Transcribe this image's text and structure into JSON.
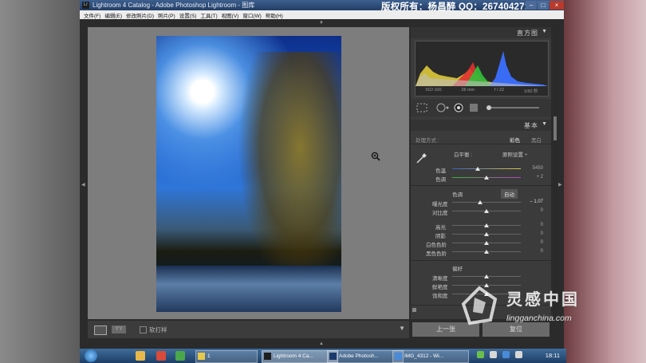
{
  "window": {
    "app_icon_text": "Lr",
    "title": "Lightroom 4 Catalog - Adobe Photoshop Lightroom - 图库",
    "copyright": "版权所有：杨昌醉 QQ：267404271",
    "min": "–",
    "max": "□",
    "close": "×"
  },
  "menu": [
    "文件(F)",
    "编辑(E)",
    "修改照片(D)",
    "照片(P)",
    "设置(S)",
    "工具(T)",
    "视图(V)",
    "窗口(W)",
    "帮助(H)"
  ],
  "histogram": {
    "title": "直方图",
    "exif": [
      "ISO 100",
      "28 mm",
      "f / 22",
      "1/60 秒"
    ],
    "colors": {
      "blue": "#3a6fff",
      "green": "#2fc23a",
      "yellow": "#e8d23a",
      "red": "#e03030"
    }
  },
  "basic": {
    "title": "基本",
    "treatment_label": "处理方式 :",
    "color_option": "彩色",
    "bw_option": "黑白",
    "wb_label": "白平衡 :",
    "wb_value": "原照设置 ÷",
    "temp_label": "色温",
    "temp_value": "5450",
    "tint_label": "色调",
    "tint_value": "+ 2",
    "tone_label": "色调",
    "auto_label": "自动",
    "exposure_label": "曝光度",
    "exposure_value": "– 1.07",
    "contrast_label": "对比度",
    "contrast_value": "0",
    "highlights_label": "高光",
    "highlights_value": "0",
    "shadows_label": "阴影",
    "shadows_value": "0",
    "whites_label": "白色色阶",
    "whites_value": "0",
    "blacks_label": "黑色色阶",
    "blacks_value": "0",
    "presence_label": "偏好",
    "clarity_label": "清晰度",
    "vibrance_label": "鲜艳度",
    "saturation_label": "饱和度"
  },
  "buttons": {
    "previous": "上一张",
    "reset": "复位"
  },
  "filmstrip": {
    "view_label": "YY",
    "softproof": "软打样"
  },
  "taskbar": {
    "tasks": [
      "1",
      "Lightroom 4 Ca...",
      "Adobe Photosh...",
      "IMG_4312 - Wi..."
    ],
    "clock": "18:11"
  },
  "watermark": {
    "cn": "灵感中国",
    "en": "lingganchina.com"
  }
}
